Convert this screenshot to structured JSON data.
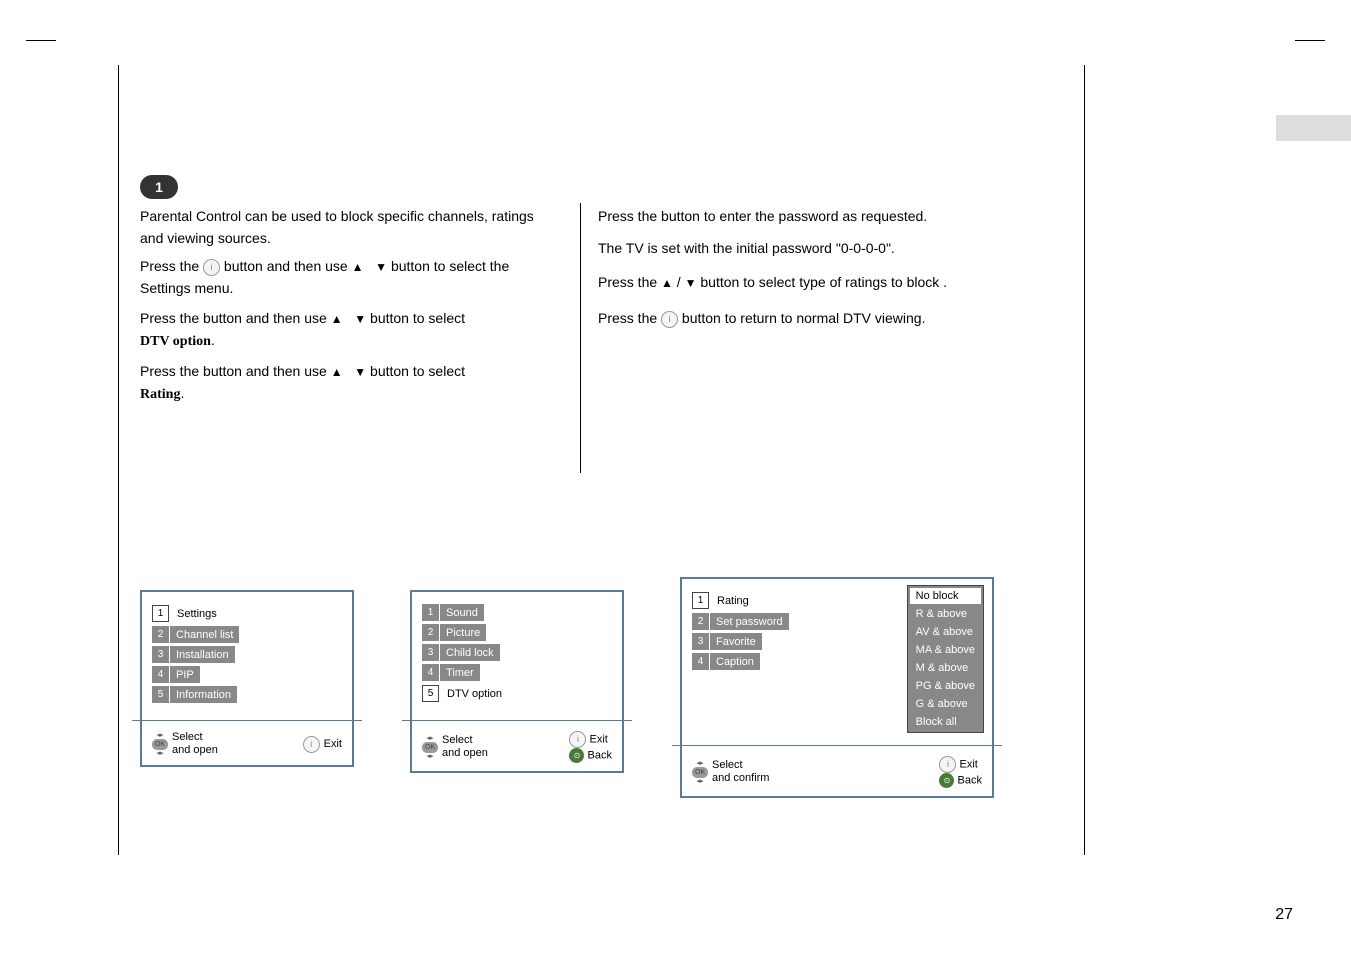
{
  "step_number": "1",
  "left": {
    "para1": "Parental Control can be used to block specific channels, ratings and viewing sources.",
    "para2a": "Press the ",
    "para2b": " button and then use ",
    "para2c": " button to select the Settings menu.",
    "para3a": "Press the       button and then use ",
    "para3b": " button to select ",
    "para3c": "DTV option",
    "para4a": "Press the       button and then use ",
    "para4b": " button to select ",
    "para4c": "Rating"
  },
  "right": {
    "para1": "Press the       button to enter the password as requested.",
    "para2": "The TV is set with the initial password \"0-0-0-0\".",
    "para3a": "Press the ",
    "para3b": " button to select type of ratings to block .",
    "para4a": "Press the ",
    "para4b": " button to return to normal DTV viewing."
  },
  "menu1": {
    "items": [
      "Settings",
      "Channel list",
      "Installation",
      "PIP",
      "Information"
    ],
    "selected_index": 0,
    "footer_select": "Select",
    "footer_open": "and open",
    "footer_exit": "Exit"
  },
  "menu2": {
    "items": [
      "Sound",
      "Picture",
      "Child lock",
      "Timer",
      "DTV option"
    ],
    "selected_index": 4,
    "footer_select": "Select",
    "footer_open": "and open",
    "footer_exit": "Exit",
    "footer_back": "Back"
  },
  "menu3": {
    "items": [
      "Rating",
      "Set password",
      "Favorite",
      "Caption"
    ],
    "selected_index": 0,
    "ratings": [
      "No     block",
      "R  &  above",
      "AV & above",
      "MA & above",
      "M   & above",
      "PG & above",
      "G   & above",
      "Block     all"
    ],
    "footer_select": "Select",
    "footer_confirm": "and confirm",
    "footer_exit": "Exit",
    "footer_back": "Back"
  },
  "page_number": "27"
}
